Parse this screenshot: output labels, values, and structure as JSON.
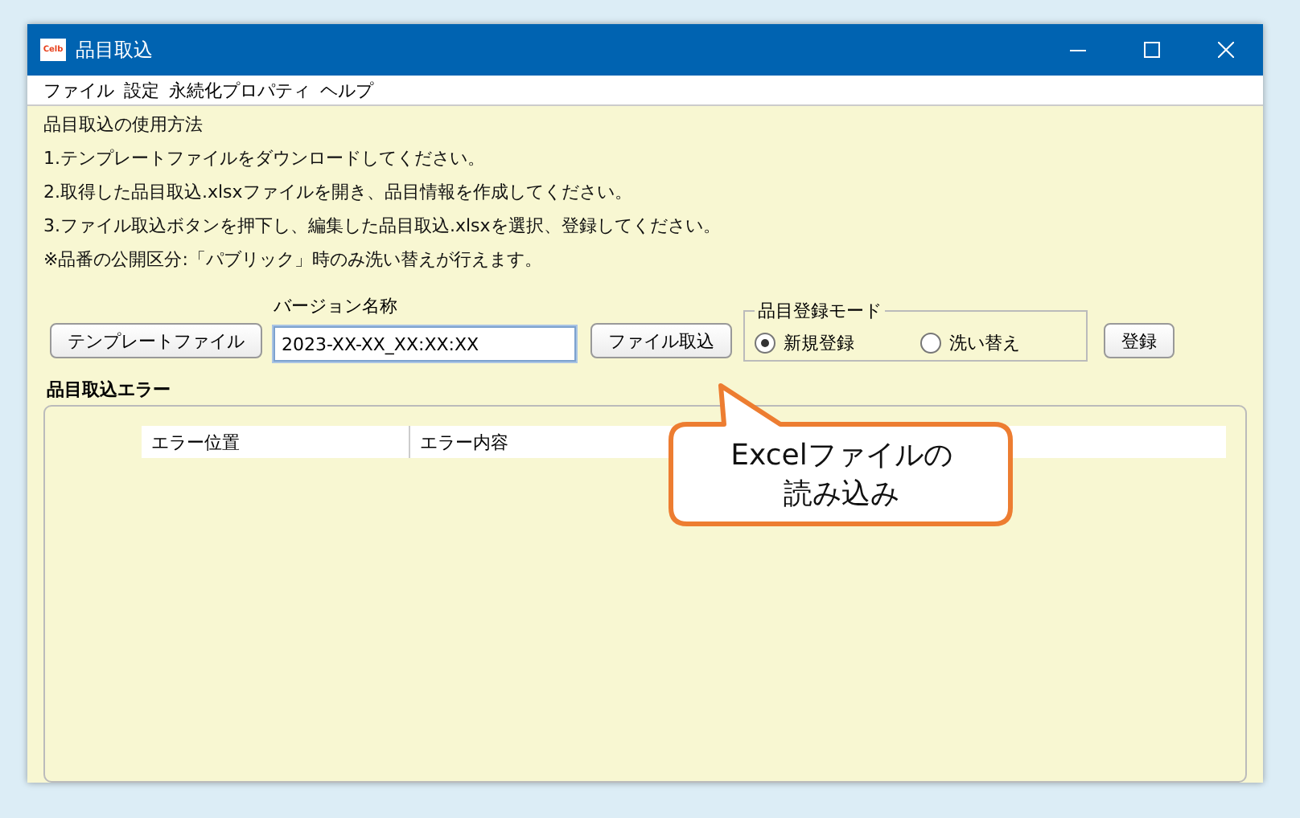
{
  "window": {
    "title": "品目取込",
    "app_icon": "Celb"
  },
  "menu": [
    "ファイル",
    "設定",
    "永続化プロパティ",
    "ヘルプ"
  ],
  "instructions": [
    "品目取込の使用方法",
    "1.テンプレートファイルをダウンロードしてください。",
    "2.取得した品目取込.xlsxファイルを開き、品目情報を作成してください。",
    "3.ファイル取込ボタンを押下し、編集した品目取込.xlsxを選択、登録してください。",
    "※品番の公開区分:「パブリック」時のみ洗い替えが行えます。"
  ],
  "template_button": "テンプレートファイル",
  "version_field": {
    "label": "バージョン名称",
    "value": "2023-XX-XX_XX:XX:XX"
  },
  "import_button": "ファイル取込",
  "mode_group": {
    "title": "品目登録モード",
    "options": [
      {
        "label": "新規登録",
        "selected": true
      },
      {
        "label": "洗い替え",
        "selected": false
      }
    ]
  },
  "register_button": "登録",
  "error_section": {
    "title": "品目取込エラー",
    "columns": [
      "エラー位置",
      "エラー内容"
    ]
  },
  "callout": {
    "lines": [
      "Excelファイルの",
      "読み込み"
    ]
  }
}
